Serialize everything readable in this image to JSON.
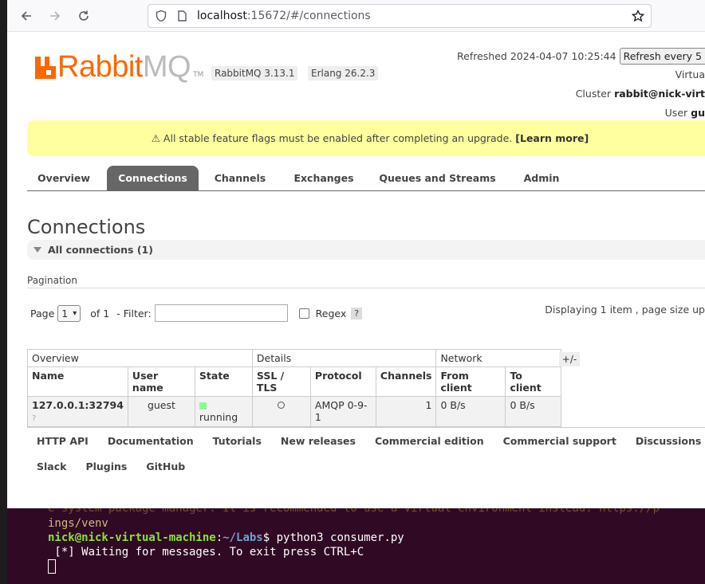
{
  "browser": {
    "url_host": "localhost",
    "url_rest": ":15672/#/connections"
  },
  "header": {
    "logo_rabbit": "Rabbit",
    "logo_mq": "MQ",
    "logo_tm": "TM",
    "version_rabbitmq": "RabbitMQ 3.13.1",
    "version_erlang": "Erlang 26.2.3",
    "refreshed": "Refreshed 2024-04-07 10:25:44",
    "refresh_select": "Refresh every 5",
    "virtual_host_label": "Virtua",
    "cluster_label": "Cluster",
    "cluster_value": "rabbit@nick-virt",
    "user_label": "User",
    "user_value": "gu"
  },
  "warning": {
    "text": "⚠ All stable feature flags must be enabled after completing an upgrade.",
    "link": "[Learn more]"
  },
  "tabs": [
    {
      "label": "Overview"
    },
    {
      "label": "Connections"
    },
    {
      "label": "Channels"
    },
    {
      "label": "Exchanges"
    },
    {
      "label": "Queues and Streams"
    },
    {
      "label": "Admin"
    }
  ],
  "main": {
    "title": "Connections",
    "section": "All connections (1)",
    "pagination_label": "Pagination",
    "page_label": "Page",
    "page_value": "1",
    "of_label": "of 1",
    "filter_label": "- Filter:",
    "regex_label": "Regex",
    "help": "?",
    "displaying": "Displaying 1 item , page size up"
  },
  "table": {
    "groups": [
      "Overview",
      "Details",
      "Network"
    ],
    "plusminus": "+/-",
    "columns": [
      "Name",
      "User name",
      "State",
      "SSL / TLS",
      "Protocol",
      "Channels",
      "From client",
      "To client"
    ],
    "rows": [
      {
        "name": "127.0.0.1:32794",
        "name_sub": "?",
        "user": "guest",
        "state": "running",
        "protocol": "AMQP 0-9-1",
        "channels": "1",
        "from_client": "0 B/s",
        "to_client": "0 B/s"
      }
    ]
  },
  "footer": {
    "row1": [
      "HTTP API",
      "Documentation",
      "Tutorials",
      "New releases",
      "Commercial edition",
      "Commercial support",
      "Discussions",
      "D"
    ],
    "row2": [
      "Slack",
      "Plugins",
      "GitHub"
    ]
  },
  "terminal": {
    "faint1": "e system package manager. It is recommended to use a virtual environment instead: https://p",
    "faint2": "ings/venv",
    "user_host": "nick@nick-virtual-machine",
    "path": "~/Labs",
    "command": "$ python3 consumer.py",
    "output": " [*] Waiting for messages. To exit press CTRL+C"
  }
}
